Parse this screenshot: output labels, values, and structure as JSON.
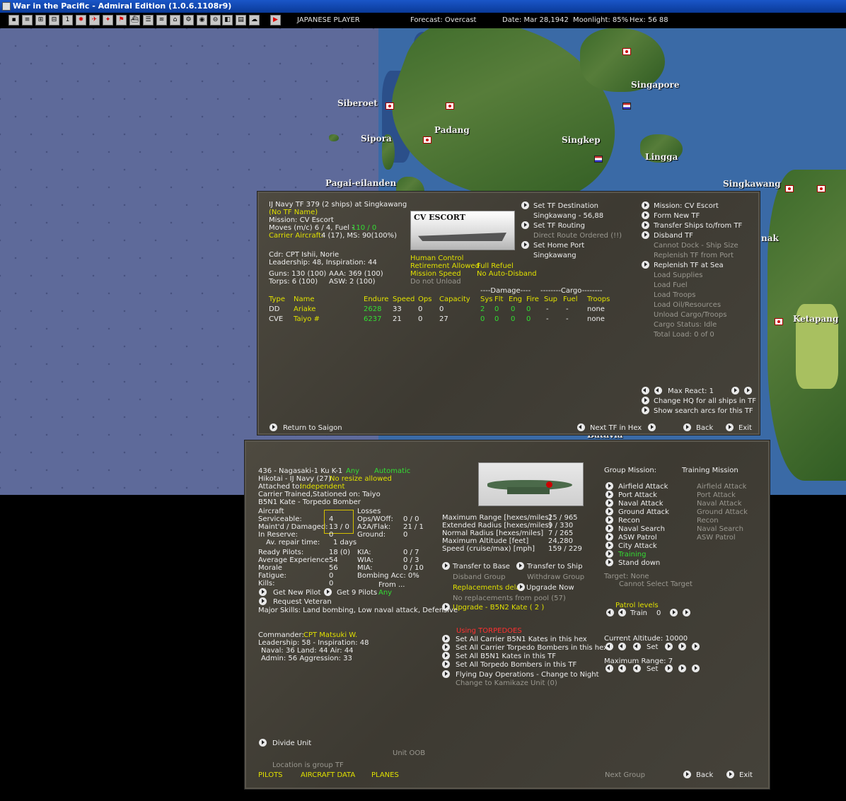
{
  "window": {
    "title": "War in the Pacific - Admiral Edition (1.0.6.1108r9)"
  },
  "header": {
    "player": "JAPANESE PLAYER",
    "forecast": "Forecast: Overcast",
    "date": "Date: Mar 28,1942",
    "moonlight": "Moonlight: 85%",
    "hex": "Hex: 56 88"
  },
  "map": {
    "labels": [
      "Siberoet",
      "Sipora",
      "Padang",
      "Singkep",
      "Lingga",
      "Singapore",
      "Pagai-eilanden",
      "Singkawang",
      "Ketapang",
      "nak",
      "Batavia"
    ]
  },
  "tf": {
    "header": "IJ Navy TF 379 (2 ships) at Singkawang",
    "name": "(No TF Name)",
    "mission": "Mission: CV Escort",
    "moves": "Moves (m/c) 6 / 4, Fuel -",
    "fuel_val": "110 / 0",
    "carrier_label": "Carrier Aircraft:",
    "carrier_val": "4 (17),  MS: 90(100%)",
    "cdr": "Cdr: CPT Ishii, Norie",
    "leadership": "Leadership: 48, Inspiration: 44",
    "guns": "Guns: 130 (100)",
    "aaa": "AAA: 369 (100)",
    "torps": "Torps: 6 (100)",
    "asw": "ASW: 2 (100)",
    "photo_caption": "CV ESCORT",
    "human_control": "Human Control",
    "retirement": "Retirement Allowed",
    "full_refuel": "Full Refuel",
    "mission_speed": "Mission Speed",
    "no_auto_disband": "No Auto-Disband",
    "do_not_unload": "Do not Unload",
    "damage_header": "----Damage----",
    "cargo_header": "--------Cargo--------",
    "columns": [
      "Type",
      "Name",
      "Endure",
      "Speed",
      "Ops",
      "Capacity",
      "Sys",
      "Flt",
      "Eng",
      "Fire",
      "Sup",
      "Fuel",
      "Troops"
    ],
    "ships": [
      {
        "type": "DD",
        "name": "Ariake",
        "endure": "2628",
        "speed": "33",
        "ops": "0",
        "capacity": "0",
        "sys": "2",
        "flt": "0",
        "eng": "0",
        "fire": "0",
        "sup": "-",
        "fuel": "-",
        "troops": "none"
      },
      {
        "type": "CVE",
        "name": "Taiyo #",
        "endure": "6237",
        "speed": "21",
        "ops": "0",
        "capacity": "27",
        "sys": "0",
        "flt": "0",
        "eng": "0",
        "fire": "0",
        "sup": "-",
        "fuel": "-",
        "troops": "none"
      }
    ],
    "set_destination": "Set TF Destination",
    "destination_val": "Singkawang - 56,88",
    "set_routing": "Set TF Routing",
    "direct_route": "Direct Route Ordered (!!)",
    "set_home_port": "Set Home Port",
    "home_port_val": "Singkawang",
    "mission_cv": "Mission: CV Escort",
    "form_new_tf": "Form New TF",
    "transfer_ships": "Transfer Ships to/from TF",
    "disband_tf": "Disband TF",
    "cannot_dock": "Cannot Dock - Ship Size",
    "replenish_port": "Replenish TF from Port",
    "replenish_sea": "Replenish TF at Sea",
    "load_supplies": "Load Supplies",
    "load_fuel": "Load Fuel",
    "load_troops": "Load Troops",
    "load_oil": "Load Oil/Resources",
    "unload_cargo": "Unload Cargo/Troops",
    "cargo_status": "Cargo Status: Idle",
    "total_load": "Total Load: 0 of 0",
    "max_react": "Max React:  1",
    "change_hq": "Change HQ for all ships in TF",
    "show_arcs": "Show search arcs for this TF",
    "return_to": "Return to Saigon",
    "next_tf": "Next TF in Hex",
    "back": "Back",
    "exit": "Exit"
  },
  "unit": {
    "line1": "436 - Nagasaki-1 Ku K-1",
    "any": "Any",
    "automatic": "Automatic",
    "line2": "Hikotai - IJ Navy (27)",
    "no_resize": "No resize allowed",
    "attached_label": "Attached to:",
    "attached_val": "Independent",
    "carrier_trained": "Carrier Trained,Stationed on: Taiyo",
    "aircraft_type": "B5N1 Kate - Torpedo Bomber",
    "aircraft": "Aircraft",
    "serviceable": "Serviceable:",
    "serviceable_val": "4",
    "maintd": "Maint'd / Damaged:",
    "maintd_val": "13 / 0",
    "reserve": "In Reserve:",
    "reserve_val": "0",
    "repair": "Av. repair time:",
    "repair_val": "1 days",
    "losses": "Losses",
    "ops_woff": "Ops/WOff:",
    "ops_woff_val": "0 / 0",
    "a2a": "A2A/Flak:",
    "a2a_val": "21 / 1",
    "ground": "Ground:",
    "ground_val": "0",
    "ready_pilots": "Ready Pilots:",
    "ready_pilots_val": "18 (0)",
    "avg_exp": "Average Experience",
    "avg_exp_val": "54",
    "morale": "Morale",
    "morale_val": "56",
    "fatigue": "Fatigue:",
    "fatigue_val": "0",
    "kills": "Kills:",
    "kills_val": "0",
    "kia": "KIA:",
    "kia_val": "0 / 7",
    "wia": "WIA:",
    "wia_val": "0 / 3",
    "mia": "MIA:",
    "mia_val": "0 / 10",
    "bombing_acc": "Bombing Acc: 0%",
    "from": "From ...",
    "get_new_pilot": "Get New Pilot",
    "get_9_pilots": "Get 9 Pilots",
    "request_veteran": "Request Veteran",
    "major_skills": "Major Skills: Land bombing, Low naval attack, Defensive",
    "commander_label": "Commander:",
    "commander_val": "CPT Matsuki W.",
    "cmd_leadership": "Leadership: 58 - Inspiration: 48",
    "cmd_naval": "Naval: 36  Land: 44  Air: 44",
    "cmd_admin": "Admin: 56  Aggression: 33",
    "max_range": "Maximum Range [hexes/miles]",
    "max_range_val": "25 / 965",
    "ext_radius": "Extended Radius [hexes/miles]",
    "ext_radius_val": "9 / 330",
    "normal_radius": "Normal Radius [hexes/miles]",
    "normal_radius_val": "7 / 265",
    "max_alt": "Maximum Altitude [feet]",
    "max_alt_val": "24,280",
    "speed": "Speed (cruise/max) [mph]",
    "speed_val": "159 / 229",
    "transfer_base": "Transfer to Base",
    "transfer_ship": "Transfer to Ship",
    "disband_group": "Disband Group",
    "withdraw_group": "Withdraw Group",
    "replacements_delay": "Replacements delay",
    "upgrade_now": "Upgrade Now",
    "no_replacements": "No replacements from pool (57)",
    "upgrade": "Upgrade - B5N2 Kate  ( 2 )",
    "using_torpedoes": "Using TORPEDOES",
    "set_carrier_hex": "Set All Carrier B5N1 Kates in this hex",
    "set_carrier_torp": "Set All Carrier Torpedo Bombers in this hex",
    "set_b5n1_tf": "Set All B5N1 Kates in this TF",
    "set_torp_tf": "Set All Torpedo Bombers in this TF",
    "flying_day": "Flying Day Operations - Change to Night",
    "change_kamikaze": "Change to Kamikaze Unit (0)",
    "group_mission": "Group Mission:",
    "training_mission": "Training Mission",
    "missions": [
      "Airfield Attack",
      "Port Attack",
      "Naval Attack",
      "Ground Attack",
      "Recon",
      "Naval Search",
      "ASW Patrol",
      "City Attack",
      "Training",
      "Stand down"
    ],
    "training_missions": [
      "Airfield Attack",
      "Port Attack",
      "Naval Attack",
      "Ground Attack",
      "Recon",
      "Naval Search",
      "ASW Patrol"
    ],
    "target": "Target: None",
    "cannot_select": "Cannot Select Target",
    "patrol_levels": "Patrol levels",
    "train": "Train",
    "train_val": "0",
    "current_alt": "Current Altitude: 10000",
    "set": "Set",
    "max_range2": "Maximum Range: 7",
    "divide_unit": "Divide Unit",
    "unit_oob": "Unit OOB",
    "location": "Location is group TF",
    "pilots": "PILOTS",
    "aircraft_data": "AIRCRAFT DATA",
    "planes": "PLANES",
    "next_group": "Next Group",
    "back": "Back",
    "exit": "Exit"
  }
}
